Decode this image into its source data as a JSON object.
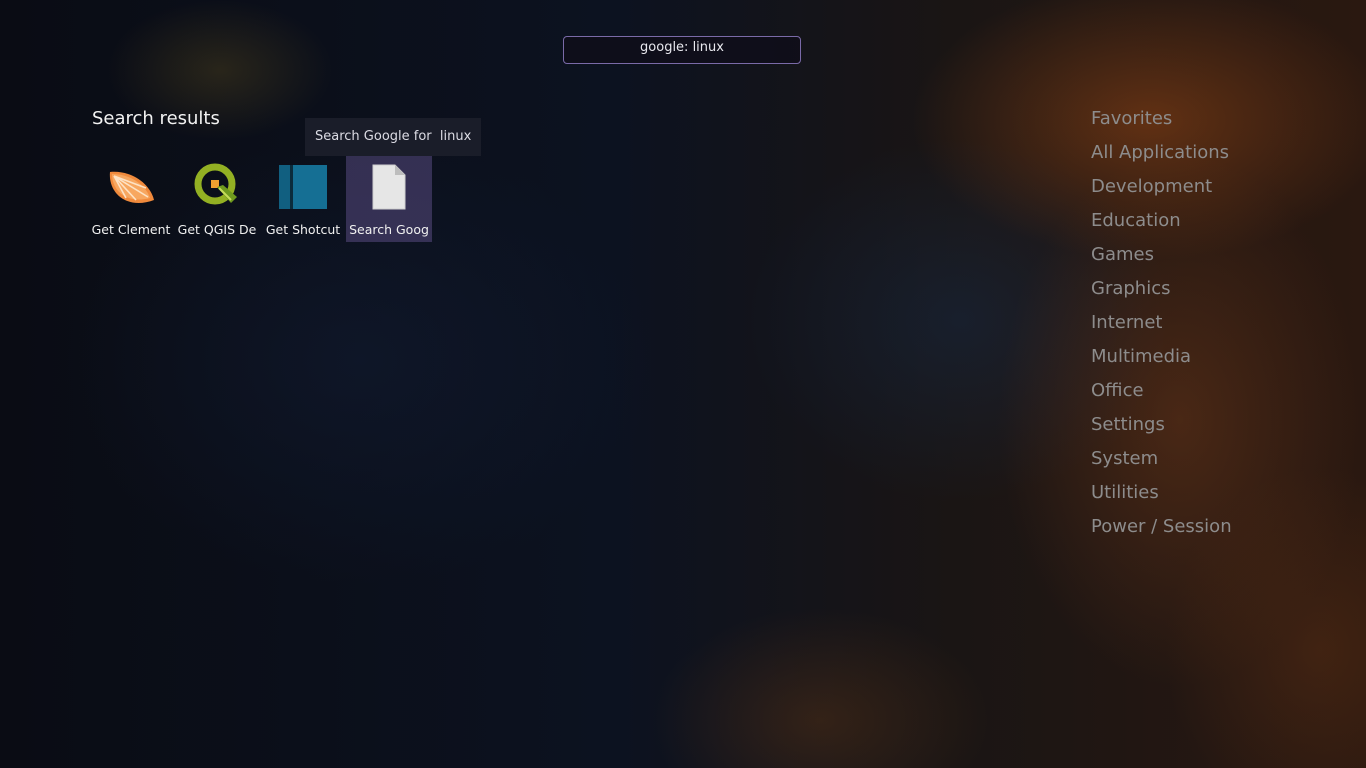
{
  "search": {
    "value": "google: linux"
  },
  "section_title": "Search results",
  "tooltip": "Search Google for  linux",
  "results": [
    {
      "label": "Get Clement",
      "icon": "clementine-icon"
    },
    {
      "label": "Get QGIS De",
      "icon": "qgis-icon"
    },
    {
      "label": "Get Shotcut",
      "icon": "shotcut-icon"
    },
    {
      "label": "Search Goog",
      "icon": "document-icon",
      "selected": true
    }
  ],
  "categories": [
    "Favorites",
    "All Applications",
    "Development",
    "Education",
    "Games",
    "Graphics",
    "Internet",
    "Multimedia",
    "Office",
    "Settings",
    "System",
    "Utilities",
    "Power / Session"
  ],
  "colors": {
    "accent_border": "#7a6aa8",
    "selection": "#4a3f6a",
    "category_text": "#8d8c8c"
  }
}
